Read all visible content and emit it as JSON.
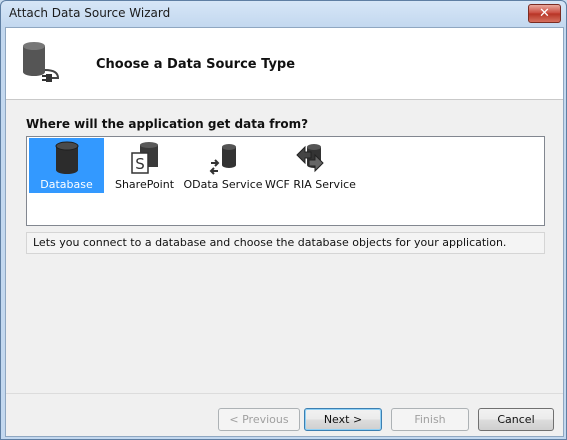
{
  "window": {
    "title": "Attach Data Source Wizard",
    "close_label": "✕"
  },
  "header": {
    "title": "Choose a Data Source Type",
    "icon": "database-connect-icon"
  },
  "main": {
    "question": "Where will the application get data from?",
    "sources": [
      {
        "label": "Database",
        "icon": "database-icon",
        "selected": true
      },
      {
        "label": "SharePoint",
        "icon": "sharepoint-icon",
        "selected": false
      },
      {
        "label": "OData Service",
        "icon": "odata-service-icon",
        "selected": false
      },
      {
        "label": "WCF RIA Service",
        "icon": "wcf-ria-service-icon",
        "selected": false
      }
    ],
    "description": "Lets you connect to a database and choose the database objects for your application."
  },
  "buttons": {
    "previous": "< Previous",
    "next": "Next >",
    "finish": "Finish",
    "cancel": "Cancel"
  },
  "colors": {
    "selection": "#3399ff",
    "title_bar": "#c3d8ef",
    "close_button": "#c8463a"
  }
}
